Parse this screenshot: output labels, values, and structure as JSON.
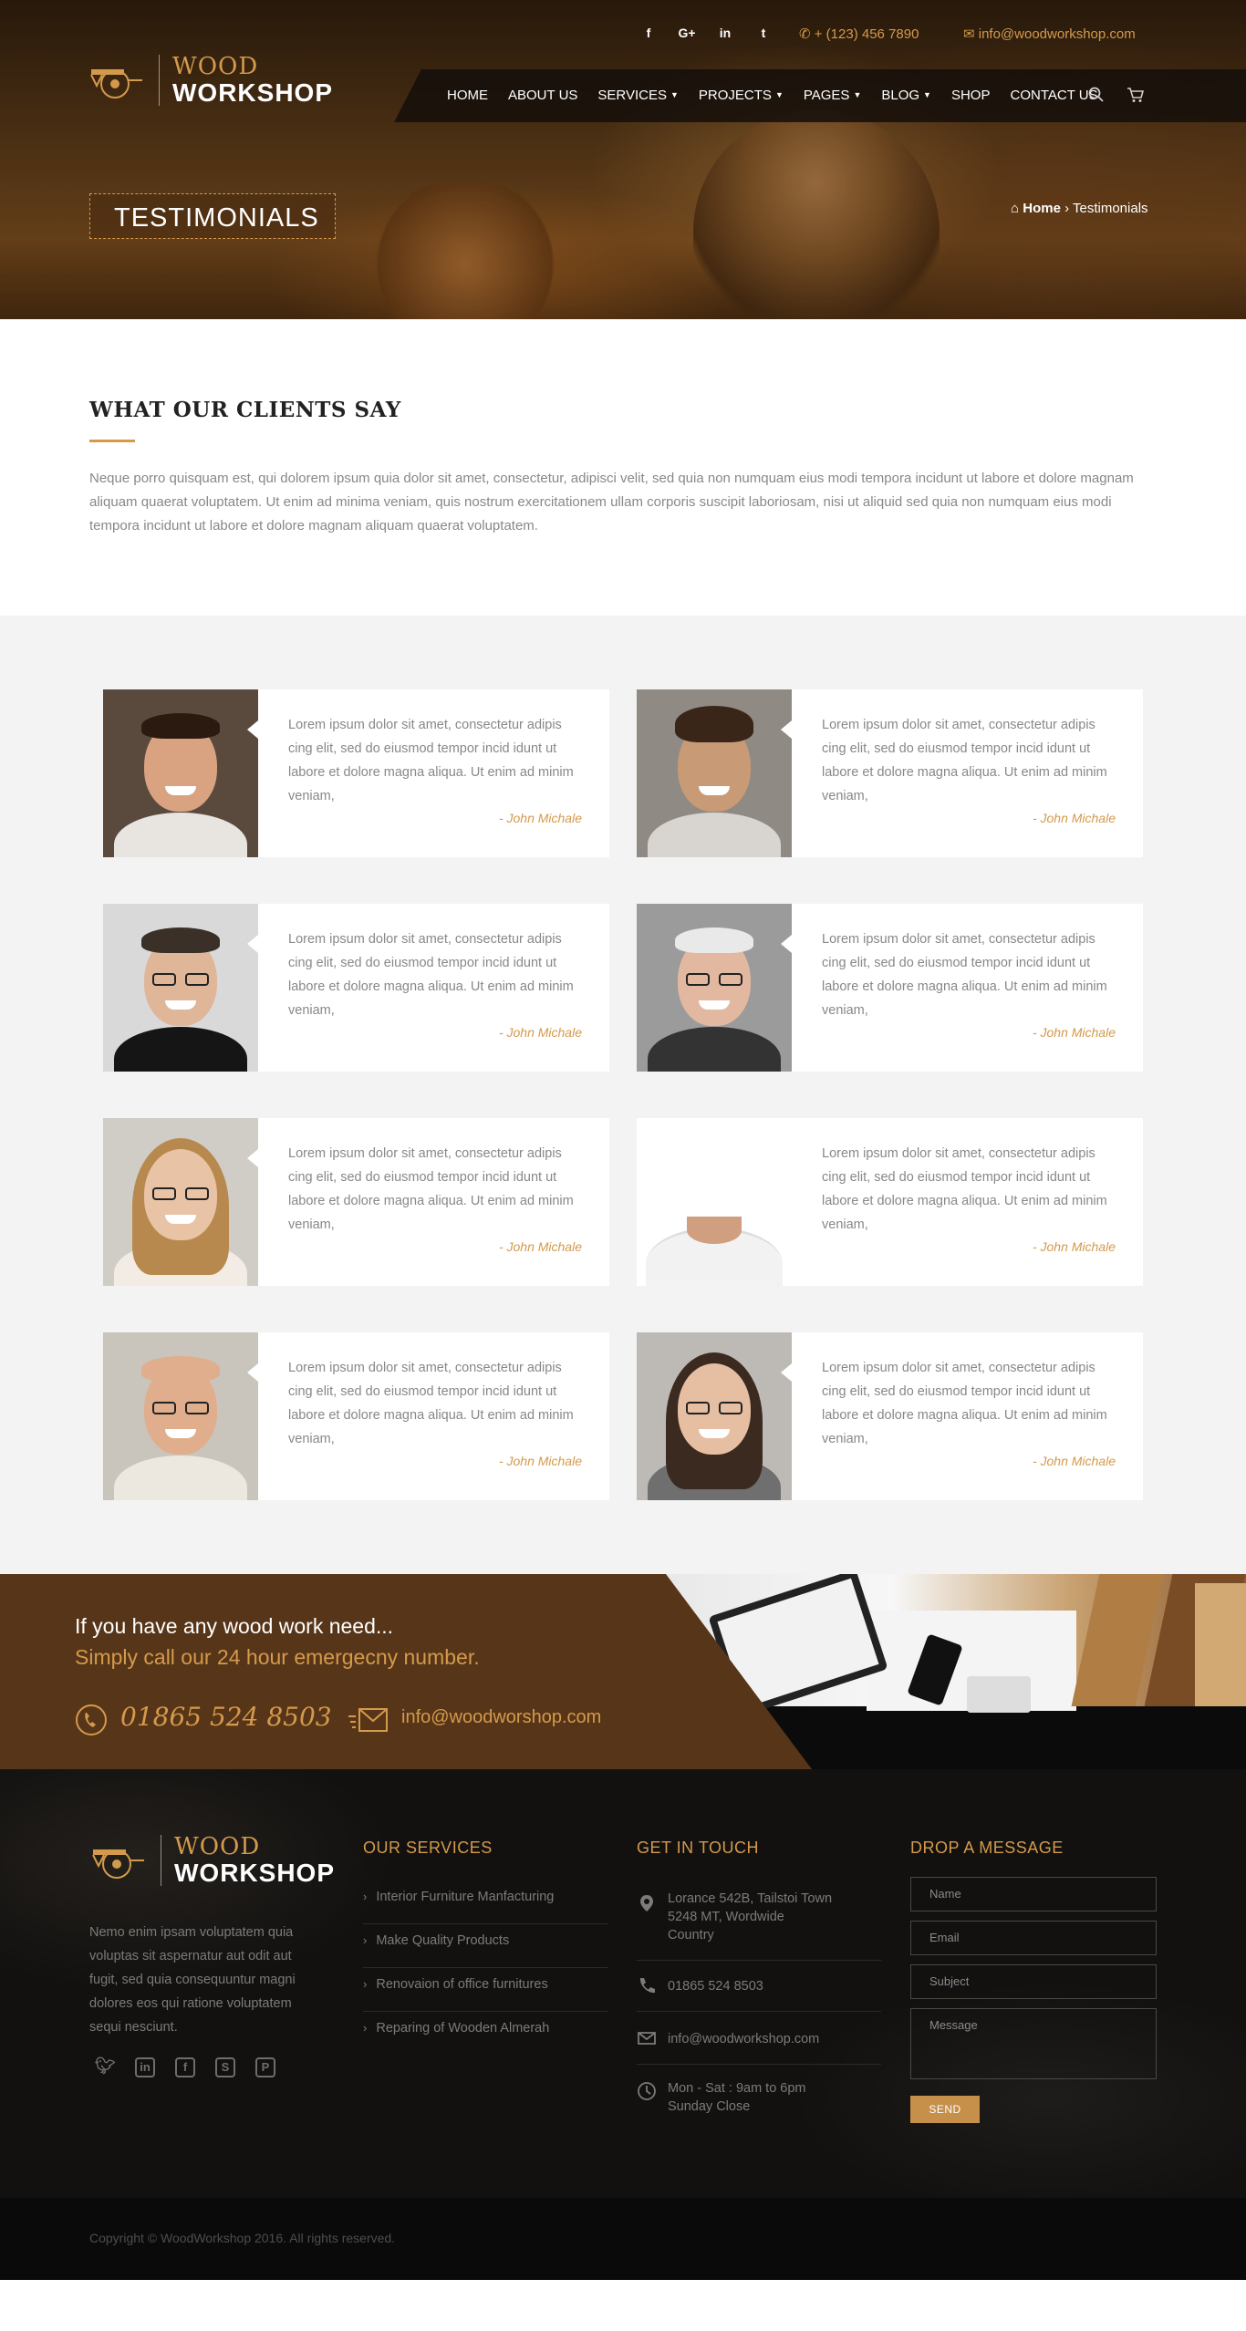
{
  "topbar": {
    "social": [
      "f",
      "G+",
      "in",
      "t"
    ],
    "phone": "+ (123) 456 7890",
    "email": "info@woodworkshop.com"
  },
  "logo": {
    "line1": "WOOD",
    "line2": "WORKSHOP"
  },
  "nav": {
    "items": [
      "HOME",
      "ABOUT US",
      "SERVICES",
      "PROJECTS",
      "PAGES",
      "BLOG",
      "SHOP",
      "CONTACT US"
    ],
    "dropdown_flags": [
      false,
      false,
      true,
      true,
      true,
      true,
      false,
      false
    ]
  },
  "hero": {
    "title": "TESTIMONIALS",
    "breadcrumb_home": "Home",
    "breadcrumb_sep": "›",
    "breadcrumb_current": "Testimonials"
  },
  "intro": {
    "heading": "WHAT OUR CLIENTS SAY",
    "text": "Neque porro quisquam est, qui dolorem ipsum quia dolor sit amet, consectetur, adipisci velit, sed quia non numquam eius modi tempora incidunt ut labore et dolore magnam aliquam quaerat voluptatem. Ut enim ad minima veniam, quis nostrum exercitationem ullam corporis suscipit laboriosam, nisi ut aliquid sed quia non numquam eius modi tempora incidunt ut labore et dolore magnam aliquam quaerat voluptatem."
  },
  "testimonials": [
    {
      "quote": "Lorem ipsum dolor sit amet, consectetur adipis cing elit, sed do eiusmod tempor incid idunt ut labore et dolore magna aliqua. Ut enim ad minim veniam,",
      "author": "- John Michale"
    },
    {
      "quote": "Lorem ipsum dolor sit amet, consectetur adipis cing elit, sed do eiusmod tempor incid idunt ut labore et dolore magna aliqua. Ut enim ad minim veniam,",
      "author": "- John Michale"
    },
    {
      "quote": "Lorem ipsum dolor sit amet, consectetur adipis cing elit, sed do eiusmod tempor incid idunt ut labore et dolore magna aliqua. Ut enim ad minim veniam,",
      "author": "- John Michale"
    },
    {
      "quote": "Lorem ipsum dolor sit amet, consectetur adipis cing elit, sed do eiusmod tempor incid idunt ut labore et dolore magna aliqua. Ut enim ad minim veniam,",
      "author": "- John Michale"
    },
    {
      "quote": "Lorem ipsum dolor sit amet, consectetur adipis cing elit, sed do eiusmod tempor incid idunt ut labore et dolore magna aliqua. Ut enim ad minim veniam,",
      "author": "- John Michale"
    },
    {
      "quote": "Lorem ipsum dolor sit amet, consectetur adipis cing elit, sed do eiusmod tempor incid idunt ut labore et dolore magna aliqua. Ut enim ad minim veniam,",
      "author": "- John Michale"
    },
    {
      "quote": "Lorem ipsum dolor sit amet, consectetur adipis cing elit, sed do eiusmod tempor incid idunt ut labore et dolore magna aliqua. Ut enim ad minim veniam,",
      "author": "- John Michale"
    },
    {
      "quote": "Lorem ipsum dolor sit amet, consectetur adipis cing elit, sed do eiusmod tempor incid idunt ut labore et dolore magna aliqua. Ut enim ad minim veniam,",
      "author": "- John Michale"
    }
  ],
  "cta": {
    "line1": "If you have any wood work need...",
    "line2": "Simply call our 24 hour emergecny number.",
    "phone": "01865 524 8503",
    "email": "info@woodworshop.com"
  },
  "footer": {
    "about": "Nemo enim ipsam voluptatem quia voluptas sit aspernatur aut odit aut fugit, sed quia consequuntur magni dolores eos qui ratione voluptatem sequi nesciunt.",
    "services_title": "OUR SERVICES",
    "services": [
      "Interior Furniture Manfacturing",
      "Make Quality Products",
      "Renovaion of office furnitures",
      "Reparing of Wooden Almerah"
    ],
    "contact_title": "GET IN TOUCH",
    "address_l1": "Lorance 542B, Tailstoi Town",
    "address_l2": "5248 MT, Wordwide",
    "address_l3": "Country",
    "phone": "01865 524 8503",
    "email": "info@woodworkshop.com",
    "hours_l1": "Mon - Sat : 9am to 6pm",
    "hours_l2": "Sunday Close",
    "form_title": "DROP A MESSAGE",
    "form": {
      "name": "Name",
      "email": "Email",
      "subject": "Subject",
      "message": "Message",
      "send": "SEND"
    },
    "copyright": "Copyright © WoodWorkshop 2016. All rights reserved."
  },
  "colors": {
    "accent": "#d49a4c",
    "cta_brown": "#573518",
    "footer_bg": "#121110",
    "section_grey": "#f3f3f3"
  }
}
